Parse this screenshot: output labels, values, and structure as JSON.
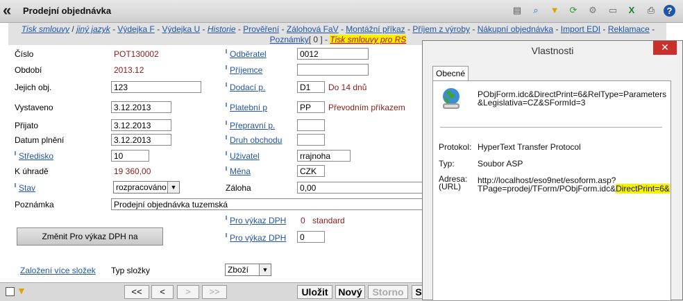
{
  "header": {
    "title": "Prodejní objednávka",
    "toolbar_icons": [
      "document-icon",
      "search-icon",
      "filter-icon",
      "refresh-icon",
      "settings-icon",
      "page-icon",
      "excel-icon",
      "print-icon",
      "help-icon"
    ]
  },
  "linkbar": {
    "links": [
      "Tisk smlouvy",
      "jiný jazyk",
      "Výdejka F",
      "Výdejka U",
      "Historie",
      "Prověření",
      "Zálohová FaV",
      "Montážní příkaz",
      "Příjem z výroby",
      "Nákupní objednávka",
      "Import EDI",
      "Reklamace",
      "Poznámky",
      "Tisk smlouvy pro RS"
    ],
    "notes_count": "[ 0 ]"
  },
  "form": {
    "cislo_label": "Číslo",
    "cislo_value": "POT130002",
    "obdobi_label": "Období",
    "obdobi_value": "2013.12",
    "jejich_label": "Jejich obj.",
    "jejich_value": "123",
    "vystaveno_label": "Vystaveno",
    "vystaveno_value": "3.12.2013",
    "prijato_label": "Přijato",
    "prijato_value": "3.12.2013",
    "datum_label": "Datum plnění",
    "datum_value": "3.12.2013",
    "stredisko_label": "Středisko",
    "stredisko_value": "10",
    "k_uhrade_label": "K úhradě",
    "k_uhrade_value": "19 360,00",
    "stav_label": "Stav",
    "stav_value": "rozpracováno",
    "poznamka_label": "Poznámka",
    "poznamka_value": "Prodejní objednávka tuzemská",
    "odberatel_label": "Odběratel",
    "odberatel_value": "0012",
    "prijemce_label": "Příjemce",
    "prijemce_value": "",
    "dodaci_label": "Dodací p.",
    "dodaci_value": "D1",
    "dodaci_text": "Do 14 dnů",
    "platebni_label": "Platební p",
    "platebni_value": "PP",
    "platebni_text": "Převodním příkazem",
    "prepravni_label": "Přepravní p.",
    "prepravni_value": "",
    "druh_label": "Druh obchodu",
    "druh_value": "",
    "uzivatel_label": "Uživatel",
    "uzivatel_value": "rrajnoha",
    "mena_label": "Měna",
    "mena_value": "CZK",
    "zaloha_label": "Záloha",
    "zaloha_value": "0,00",
    "pro_vykaz1_label": "Pro výkaz DPH",
    "pro_vykaz1_code": "0",
    "pro_vykaz1_text": "standard",
    "pro_vykaz2_label": "Pro výkaz DPH",
    "pro_vykaz2_value": "0",
    "change_button": "Změnit Pro výkaz DPH na",
    "zalozeni_link": "Založení více složek",
    "typ_label": "Typ složky",
    "typ_value": "Zboží"
  },
  "bottom": {
    "first": "<<",
    "prev": "<",
    "next": ">",
    "last": ">>",
    "save": "Uložit",
    "new": "Nový",
    "cancel": "Storno",
    "more": "S"
  },
  "dialog": {
    "title": "Vlastnosti",
    "tab": "Obecné",
    "object_line1": "PObjForm.idc&DirectPrint=6&RelType=Parameters",
    "object_line2": "&Legislativa=CZ&SFormId=3",
    "protocol_label": "Protokol:",
    "protocol_value": "HyperText Transfer Protocol",
    "type_label": "Typ:",
    "type_value": "Soubor ASP",
    "address_label1": "Adresa:",
    "address_label2": "(URL)",
    "address_line1": "http://localhost/eso9net/esoform.asp?",
    "address_line2a": "TPage=prodej/TForm/PObjForm.idc&",
    "address_line2b": "DirectPrint=6&"
  }
}
